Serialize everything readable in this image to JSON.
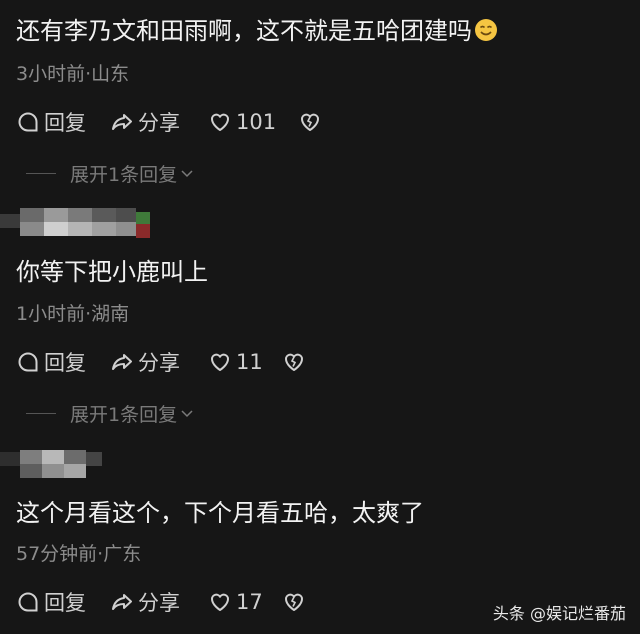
{
  "comments": [
    {
      "text": "还有李乃文和田雨啊，这不就是五哈团建吗",
      "emoji": "smiling-face-emoji",
      "meta": "3小时前·山东",
      "reply_label": "回复",
      "share_label": "分享",
      "likes": "101",
      "expand_label": "展开1条回复"
    },
    {
      "text": "你等下把小鹿叫上",
      "meta": "1小时前·湖南",
      "reply_label": "回复",
      "share_label": "分享",
      "likes": "11",
      "expand_label": "展开1条回复"
    },
    {
      "text": "这个月看这个，下个月看五哈，太爽了",
      "meta": "57分钟前·广东",
      "reply_label": "回复",
      "share_label": "分享",
      "likes": "17"
    }
  ],
  "watermark": "头条 @娱记烂番茄",
  "icons": {
    "reply": "reply-bubble-icon",
    "share": "share-arrow-icon",
    "like": "heart-icon",
    "dislike": "broken-heart-icon",
    "expand": "chevron-down-icon"
  },
  "colors": {
    "background": "#161616",
    "text": "#f2f2f2",
    "meta": "#8c8c8c"
  }
}
